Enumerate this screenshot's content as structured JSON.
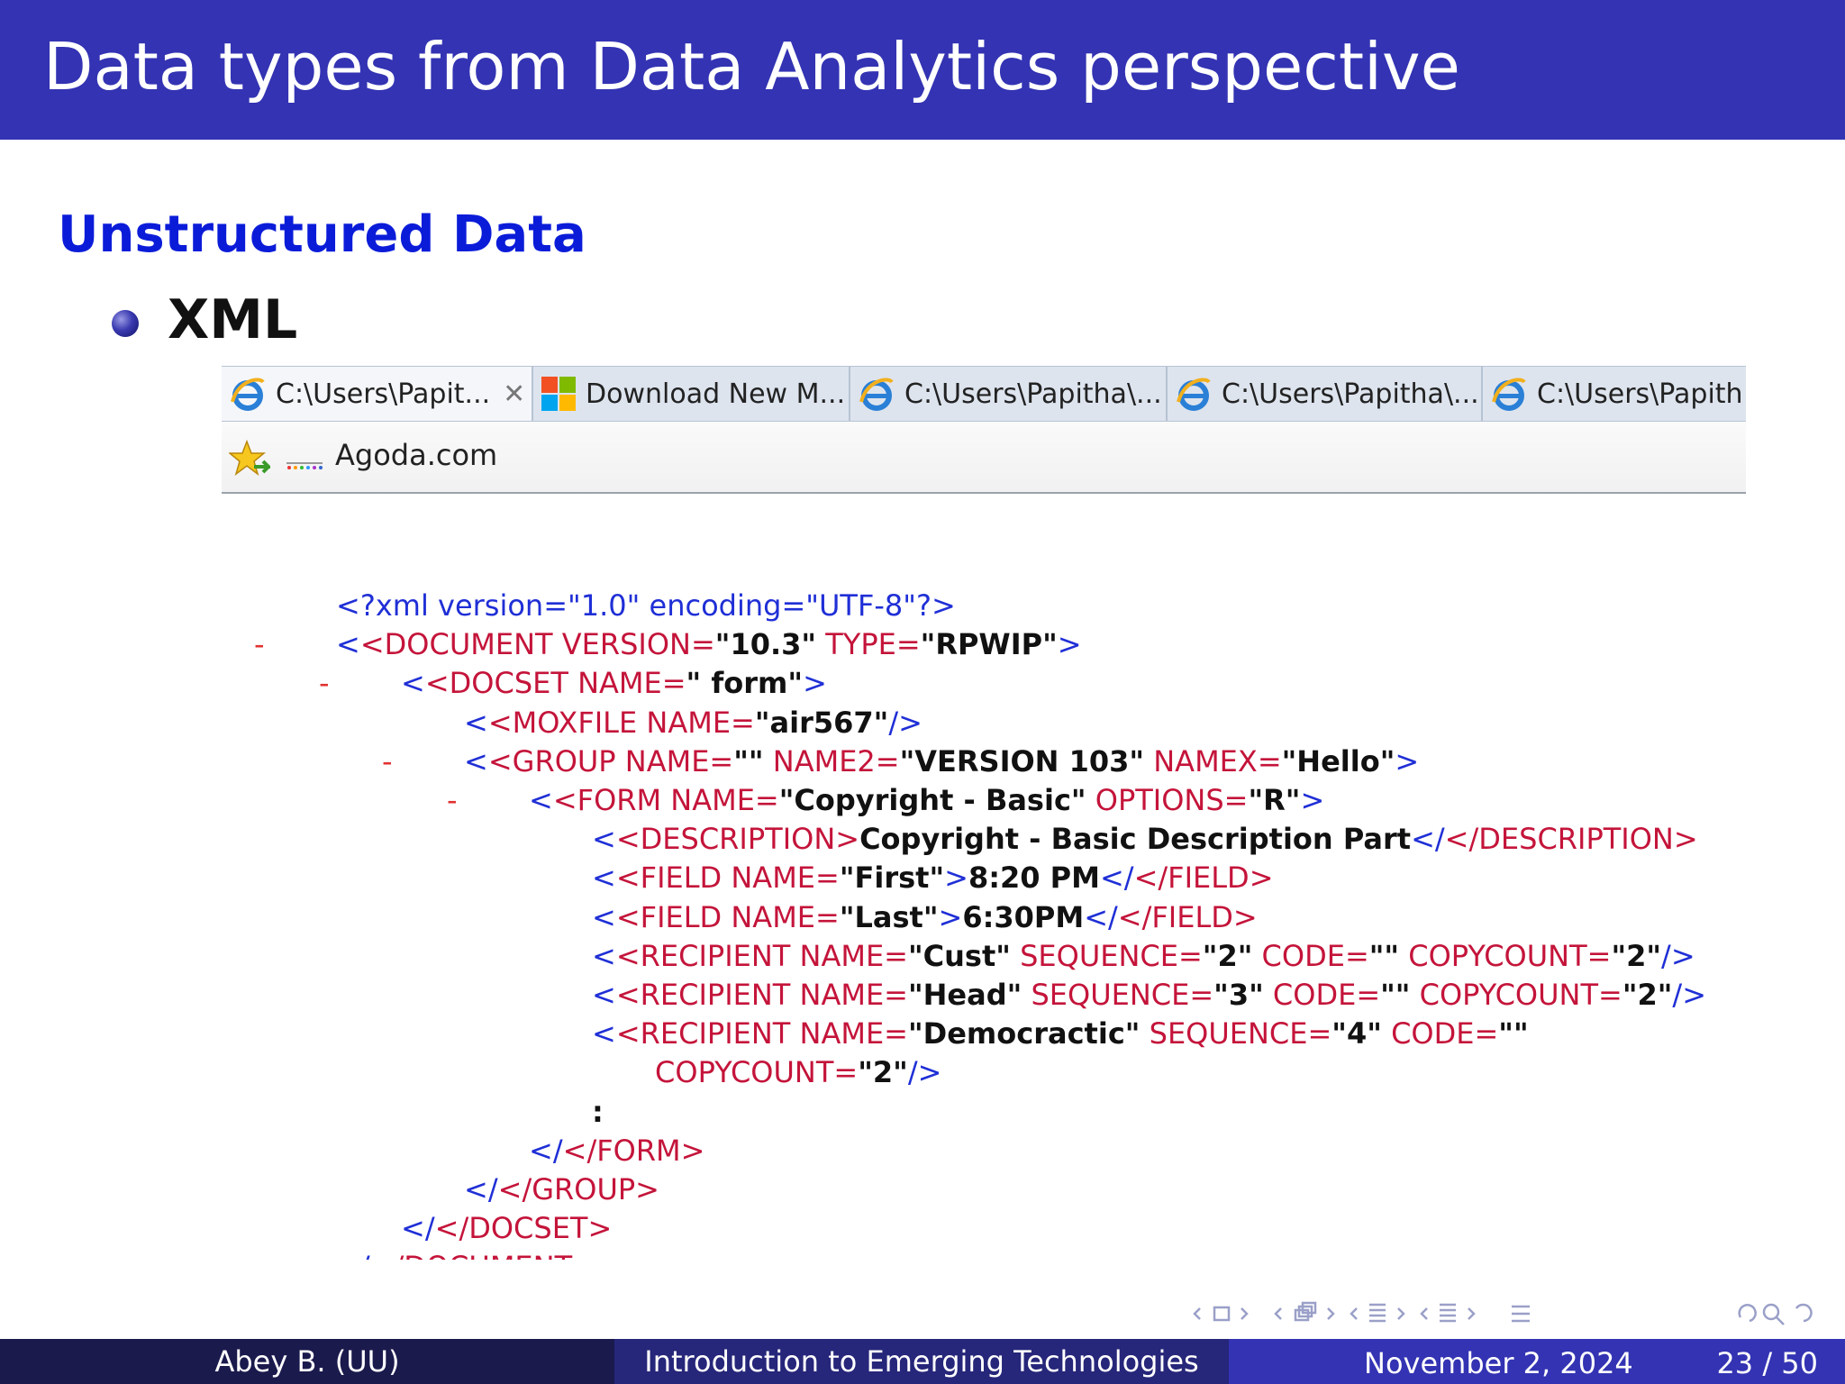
{
  "slide": {
    "title": "Data types from Data Analytics perspective",
    "section_heading": "Unstructured Data",
    "bullet": "XML"
  },
  "browser": {
    "tabs": [
      {
        "label": "C:\\Users\\Papit...",
        "icon": "ie-icon",
        "close": "✕"
      },
      {
        "label": "Download New M...",
        "icon": "windows-icon"
      },
      {
        "label": "C:\\Users\\Papitha\\...",
        "icon": "ie-icon"
      },
      {
        "label": "C:\\Users\\Papitha\\...",
        "icon": "ie-icon"
      },
      {
        "label": "C:\\Users\\Papith",
        "icon": "ie-icon"
      }
    ],
    "favorites": {
      "star_icon": "favorites-star-icon",
      "site_icon": "agoda-site-icon",
      "label": "Agoda.com"
    }
  },
  "xml": {
    "l1": {
      "a": "<?xml version=\"1.0\" encoding=\"UTF-8\"?>"
    },
    "l2": {
      "minus": "-",
      "a": "<DOCUMENT VERSION=",
      "b": "\"10.3\"",
      "c": " TYPE=",
      "d": "\"RPWIP\"",
      "e": ">"
    },
    "l3": {
      "minus": "-",
      "a": "<DOCSET NAME=",
      "b": "\" form\"",
      "c": ">"
    },
    "l4": {
      "a": "<MOXFILE NAME=",
      "b": "\"air567\"",
      "c": "/>"
    },
    "l5": {
      "minus": "-",
      "a": "<GROUP NAME=",
      "b": "\"\"",
      "c": " NAME2=",
      "d": "\"VERSION 103\"",
      "e": " NAMEX=",
      "f": "\"Hello\"",
      "g": ">"
    },
    "l6": {
      "minus": "-",
      "a": "<FORM NAME=",
      "b": "\"Copyright - Basic\"",
      "c": " OPTIONS=",
      "d": "\"R\"",
      "e": ">"
    },
    "l7": {
      "a": "<DESCRIPTION>",
      "b": "Copyright - Basic Description Part",
      "c": "</DESCRIPTION>"
    },
    "l8": {
      "a": "<FIELD NAME=",
      "b": "\"First\"",
      "c": ">",
      "d": "8:20 PM",
      "e": "</FIELD>"
    },
    "l9": {
      "a": "<FIELD NAME=",
      "b": "\"Last\"",
      "c": ">",
      "d": "6:30PM",
      "e": "</FIELD>"
    },
    "l10": {
      "a": "<RECIPIENT NAME=",
      "b": "\"Cust\"",
      "c": " SEQUENCE=",
      "d": "\"2\"",
      "e": " CODE=",
      "f": "\"\"",
      "g": " COPYCOUNT=",
      "h": "\"2\"",
      "i": "/>"
    },
    "l11": {
      "a": "<RECIPIENT NAME=",
      "b": "\"Head\"",
      "c": " SEQUENCE=",
      "d": "\"3\"",
      "e": " CODE=",
      "f": "\"\"",
      "g": " COPYCOUNT=",
      "h": "\"2\"",
      "i": "/>"
    },
    "l12": {
      "a": "<RECIPIENT NAME=",
      "b": "\"Democractic\"",
      "c": " SEQUENCE=",
      "d": "\"4\"",
      "e": " CODE=",
      "f": "\"\""
    },
    "l13": {
      "a": "COPYCOUNT=",
      "b": "\"2\"",
      "c": "/>"
    },
    "l14": {
      "a": ":"
    },
    "l15": {
      "a": "</FORM>"
    },
    "l16": {
      "a": "</GROUP>"
    },
    "l17": {
      "a": "</DOCSET>"
    },
    "l18": {
      "a": "</DOCUMENT>"
    }
  },
  "nav": {
    "icons": [
      "nav-prev-icon",
      "nav-frame-icon",
      "nav-next-icon",
      "nav-subsection-icon",
      "nav-section-icon",
      "nav-align-icon",
      "nav-search-icon"
    ]
  },
  "footer": {
    "author": "Abey B.  (UU)",
    "course": "Introduction to Emerging Technologies",
    "date": "November 2, 2024",
    "page": "23 / 50"
  },
  "colors": {
    "title_bar": "#3333b3",
    "heading": "#0b1cd9",
    "xml_blue": "#1f2fd6",
    "xml_red": "#c4143a",
    "footer_dark": "#1a1a4d",
    "footer_mid": "#26267a"
  }
}
